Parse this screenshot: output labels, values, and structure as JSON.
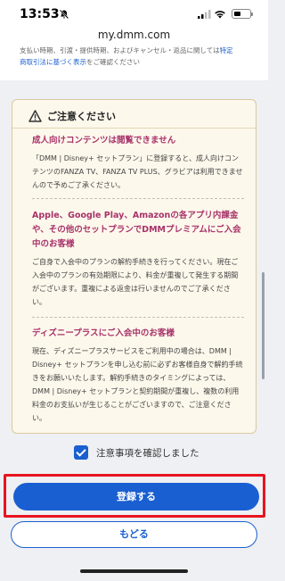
{
  "status_bar": {
    "time": "13:53"
  },
  "url_bar": {
    "url": "my.dmm.com"
  },
  "top_note": {
    "line1_text": "支払い時期、引渡・提供時期、およびキャンセル・返品に関しては",
    "line1_link": "特定",
    "line2_link": "商取引法に基づく表示",
    "line2_text": "をご確認ください"
  },
  "notice": {
    "title": "ご注意ください",
    "sections": [
      {
        "title": "成人向けコンテンツは閲覧できません",
        "body": "「DMM | Disney+ セットプラン」に登録すると、成人向けコンテンツのFANZA TV、FANZA TV PLUS、グラビアは利用できませんので予めご了承ください。"
      },
      {
        "title": "Apple、Google Play、Amazonの各アプリ内課金や、その他のセットプランでDMMプレミアムにご入会中のお客様",
        "body": "ご自身で入会中のプランの解約手続きを行ってください。現在ご入会中のプランの有効期限により、料金が重複して発生する期間がございます。重複による返金は行いませんのでご了承ください。"
      },
      {
        "title": "ディズニープラスにご入会中のお客様",
        "body": "現在、ディズニープラスサービスをご利用中の場合は、DMM | Disney+ セットプランを申し込む前に必ずお客様自身で解約手続きをお願いいたします。解約手続きのタイミングによっては、DMM | Disney+ セットプランと契約期間が重複し、複数の利用料金のお支払いが生じることがございますので、ご注意ください。"
      }
    ]
  },
  "agree": {
    "label": "注意事項を確認しました",
    "checked": true
  },
  "buttons": {
    "register": "登録する",
    "back": "もどる"
  },
  "colors": {
    "accent": "#1a5fd1",
    "highlight": "#e8131e",
    "section_title": "#a8326a"
  },
  "icons": {
    "bell": "bell-slash-icon",
    "signal": "signal-icon",
    "wifi": "wifi-icon",
    "battery": "battery-icon",
    "warning": "warning-icon",
    "checkbox": "checkbox-checked"
  }
}
